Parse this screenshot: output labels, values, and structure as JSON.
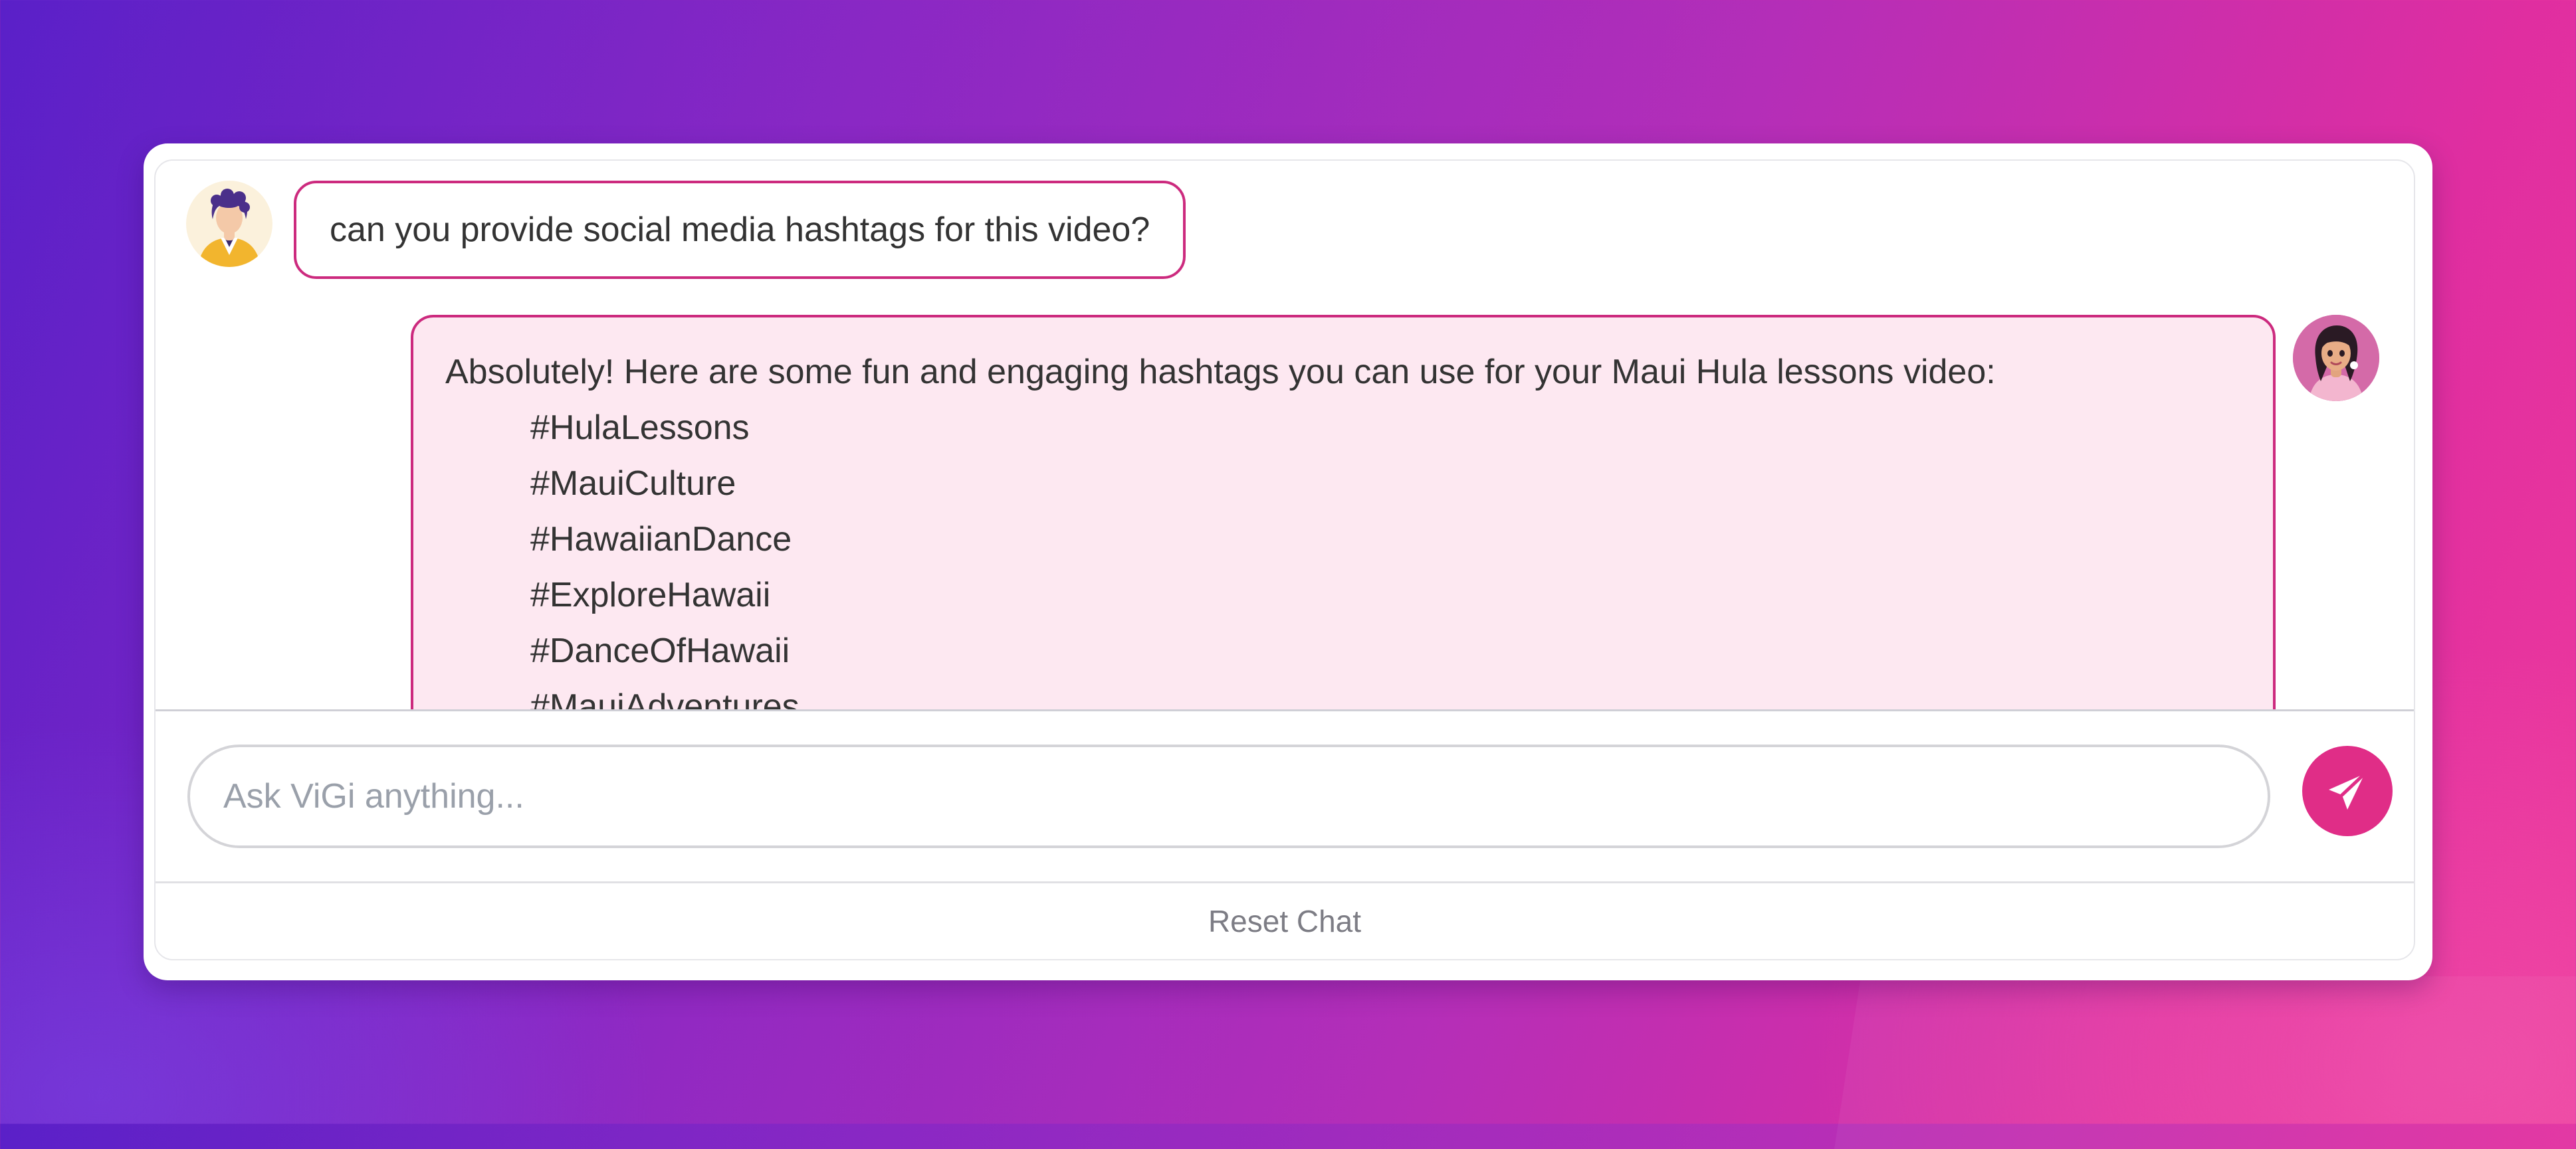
{
  "chat": {
    "messages": [
      {
        "role": "user",
        "avatar": "user-avatar-icon",
        "text": "can you provide social media hashtags for this video?"
      },
      {
        "role": "assistant",
        "avatar": "vigi-avatar-icon",
        "intro": "Absolutely! Here are some fun and engaging hashtags you can use for your Maui Hula lessons video:",
        "hashtags": [
          "#HulaLessons",
          "#MauiCulture",
          "#HawaiianDance",
          "#ExploreHawaii",
          "#DanceOfHawaii",
          "#MauiAdventures"
        ]
      }
    ]
  },
  "composer": {
    "placeholder": "Ask ViGi anything...",
    "value": "",
    "send_icon": "paper-plane-icon"
  },
  "footer": {
    "reset_label": "Reset Chat"
  },
  "colors": {
    "accent": "#e02d87",
    "bubble_border": "#cc2a7e",
    "assistant_bubble_bg": "#fde8f1",
    "background_start": "#5a20c8",
    "background_end": "#ee3a9c"
  }
}
